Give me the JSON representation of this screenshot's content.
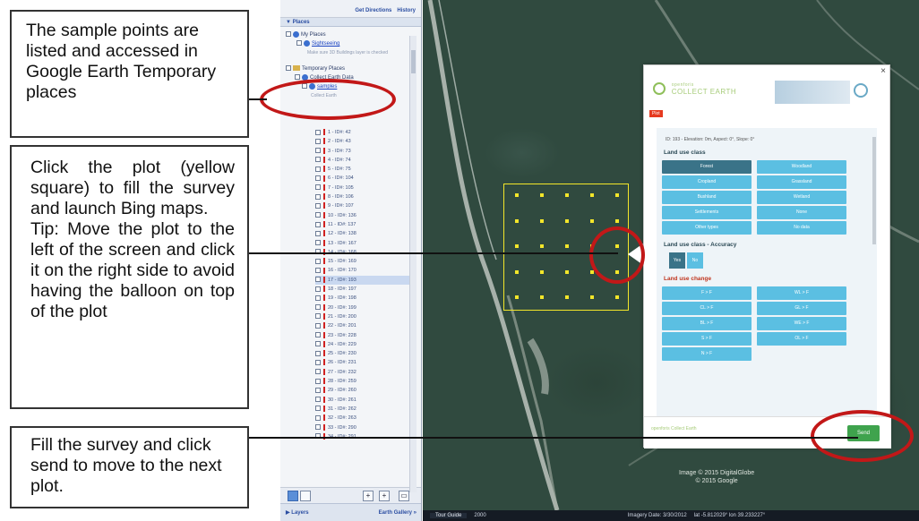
{
  "callouts": {
    "c1": "The sample points are listed and accessed in Google Earth Temporary places",
    "c2_p1": "Click the plot (yellow square) to fill the survey and launch Bing maps.",
    "c2_p2": "Tip: Move the plot to the left of the screen and click it on the right side to avoid having the balloon on top of the plot",
    "c3": "Fill the survey and click send to move to the next plot."
  },
  "sidebar": {
    "get_directions": "Get Directions",
    "history": "History",
    "places_header": "▼ Places",
    "tree": [
      {
        "label": "My Places",
        "type": "globe"
      },
      {
        "label": "Sightseeing",
        "type": "link"
      },
      {
        "label": "Make sure 3D Buildings layer is checked",
        "type": "sub"
      },
      {
        "label": "Temporary Places",
        "type": "folder"
      },
      {
        "label": "Collect Earth Data",
        "type": "globe"
      },
      {
        "label": "samples",
        "type": "link"
      },
      {
        "label": "Collect Earth",
        "type": "sub"
      }
    ],
    "points": [
      "1 - ID#: 42",
      "2 - ID#: 43",
      "3 - ID#: 73",
      "4 - ID#: 74",
      "5 - ID#: 75",
      "6 - ID#: 104",
      "7 - ID#: 105",
      "8 - ID#: 106",
      "9 - ID#: 107",
      "10 - ID#: 136",
      "11 - ID#: 137",
      "12 - ID#: 138",
      "13 - ID#: 167",
      "14 - ID#: 168",
      "15 - ID#: 169",
      "16 - ID#: 170",
      "17 - ID#: 193",
      "18 - ID#: 197",
      "19 - ID#: 198",
      "20 - ID#: 199",
      "21 - ID#: 200",
      "22 - ID#: 201",
      "23 - ID#: 228",
      "24 - ID#: 229",
      "25 - ID#: 230",
      "26 - ID#: 231",
      "27 - ID#: 232",
      "28 - ID#: 259",
      "29 - ID#: 260",
      "30 - ID#: 261",
      "31 - ID#: 262",
      "32 - ID#: 263",
      "33 - ID#: 290",
      "34 - ID#: 291"
    ],
    "selected_point": "17 - ID#: 193",
    "layers": "▶ Layers",
    "earth_gallery": "Earth Gallery »"
  },
  "map": {
    "tour_guide": "Tour Guide",
    "status_year": "2000",
    "imagery_date": "Imagery Date: 3/30/2012",
    "coords": "lat   -5.812029°  lon   39.233227°",
    "attribution_1": "Image © 2015 DigitalGlobe",
    "attribution_2": "© 2015 Google"
  },
  "balloon": {
    "logo": "COLLECT EARTH",
    "logo_sub": "openforis",
    "tag": "Plot",
    "meta": "ID: 193 - Elevation: 0m, Aspect: 0°, Slope: 0°",
    "land_use_class": "Land use class",
    "lu_buttons": [
      "Forest",
      "Woodland",
      "Cropland",
      "Grassland",
      "Bushland",
      "Wetland",
      "Settlements",
      "None",
      "Other types",
      "No data"
    ],
    "accuracy_title": "Land use class - Accuracy",
    "accuracy_buttons": [
      "Yes",
      "No"
    ],
    "change_title": "Land use change",
    "change_buttons": [
      "F > F",
      "WL > F",
      "CL > F",
      "GL > F",
      "BL > F",
      "WE > F",
      "S > F",
      "OL > F",
      "N > F"
    ],
    "footer_logo": "openforis Collect Earth",
    "send": "Send",
    "close": "×"
  }
}
